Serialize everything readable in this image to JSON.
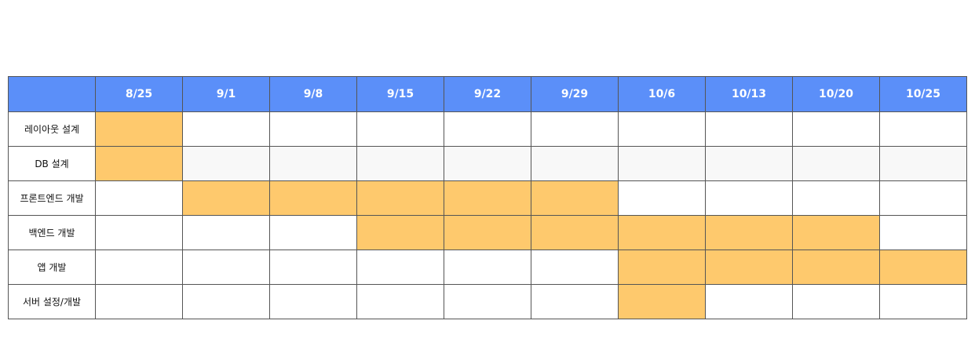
{
  "weeks": [
    "8/25",
    "9/1",
    "9/8",
    "9/15",
    "9/22",
    "9/29",
    "10/6",
    "10/13",
    "10/20",
    "10/25"
  ],
  "tasks": [
    {
      "label": "레이아웃 설계",
      "active": [
        0
      ]
    },
    {
      "label": "DB 설계",
      "active": [
        0
      ]
    },
    {
      "label": "프론트엔드 개발",
      "active": [
        1,
        2,
        3,
        4,
        5
      ]
    },
    {
      "label": "백엔드 개발",
      "active": [
        3,
        4,
        5,
        6,
        7,
        8
      ]
    },
    {
      "label": "앱 개발",
      "active": [
        6,
        7,
        8,
        9
      ]
    },
    {
      "label": "서버 설정/개발",
      "active": [
        6
      ]
    }
  ],
  "colors": {
    "header": "#5b8ff9",
    "bar": "#fec96d"
  }
}
